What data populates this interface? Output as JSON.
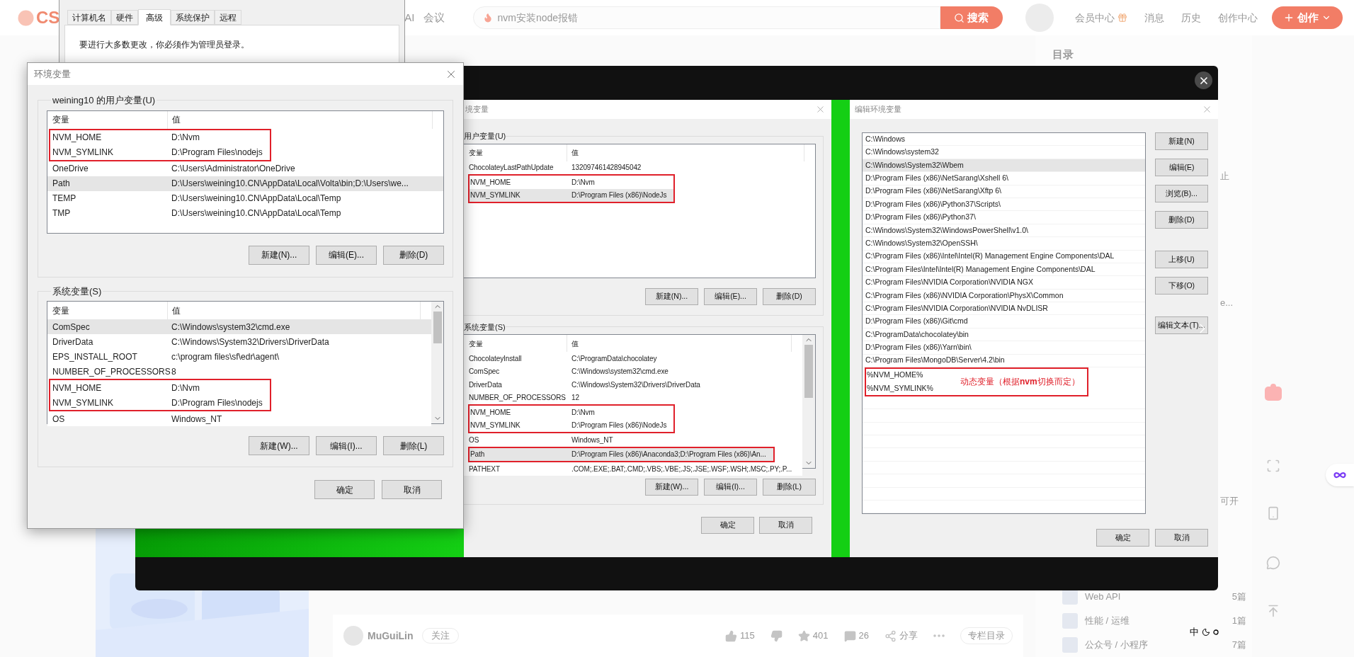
{
  "page": {
    "logo": "CS",
    "nav": [
      "AI",
      "会议"
    ],
    "search": {
      "placeholder": "nvm安装node报错",
      "button": "搜索"
    },
    "links": [
      "会员中心",
      "消息",
      "历史",
      "创作中心"
    ],
    "create_button": "创作",
    "toc_title": "目录",
    "fragments": [
      "止",
      "e...",
      "可开"
    ],
    "author": {
      "name": "MuGuiLin",
      "follow": "关注"
    },
    "actions": [
      {
        "kind": "like",
        "label": "115"
      },
      {
        "kind": "dislike"
      },
      {
        "kind": "star",
        "label": "401"
      },
      {
        "kind": "comment",
        "label": "26"
      },
      {
        "kind": "share",
        "label": "分享"
      },
      {
        "kind": "more"
      }
    ],
    "column_button": "专栏目录",
    "columns": [
      {
        "name": "Web API",
        "count": "5篇"
      },
      {
        "name": "性能 / 运维",
        "count": "1篇"
      },
      {
        "name": "公众号 / 小程序",
        "count": "7篇"
      }
    ],
    "ime": "中"
  },
  "system_properties": {
    "tabs": [
      {
        "label": "计算机名",
        "selected": false
      },
      {
        "label": "硬件",
        "selected": false
      },
      {
        "label": "高级",
        "selected": true
      },
      {
        "label": "系统保护",
        "selected": false
      },
      {
        "label": "远程",
        "selected": false
      }
    ],
    "notice": "要进行大多数更改，你必须作为管理员登录。"
  },
  "env_dialog": {
    "title": "环境变量",
    "user_group": {
      "label": "weining10 的用户变量(U)",
      "columns": [
        "变量",
        "值"
      ],
      "rows": [
        {
          "name": "NVM_HOME",
          "value": "D:\\Nvm",
          "selected": false,
          "marked": true
        },
        {
          "name": "NVM_SYMLINK",
          "value": "D:\\Program Files\\nodejs",
          "selected": false,
          "marked": true
        },
        {
          "name": "OneDrive",
          "value": "C:\\Users\\Administrator\\OneDrive",
          "selected": false,
          "marked": false
        },
        {
          "name": "Path",
          "value": "D:\\Users\\weining10.CN\\AppData\\Local\\Volta\\bin;D:\\Users\\we...",
          "selected": true,
          "marked": false
        },
        {
          "name": "TEMP",
          "value": "D:\\Users\\weining10.CN\\AppData\\Local\\Temp",
          "selected": false,
          "marked": false
        },
        {
          "name": "TMP",
          "value": "D:\\Users\\weining10.CN\\AppData\\Local\\Temp",
          "selected": false,
          "marked": false
        }
      ],
      "buttons": [
        "新建(N)...",
        "编辑(E)...",
        "删除(D)"
      ]
    },
    "system_group": {
      "label": "系统变量(S)",
      "columns": [
        "变量",
        "值"
      ],
      "rows": [
        {
          "name": "ComSpec",
          "value": "C:\\Windows\\system32\\cmd.exe",
          "selected": true,
          "marked": false
        },
        {
          "name": "DriverData",
          "value": "C:\\Windows\\System32\\Drivers\\DriverData",
          "selected": false,
          "marked": false
        },
        {
          "name": "EPS_INSTALL_ROOT",
          "value": "c:\\program files\\sf\\edr\\agent\\",
          "selected": false,
          "marked": false
        },
        {
          "name": "NUMBER_OF_PROCESSORS",
          "value": "8",
          "selected": false,
          "marked": false
        },
        {
          "name": "NVM_HOME",
          "value": "D:\\Nvm",
          "selected": false,
          "marked": true
        },
        {
          "name": "NVM_SYMLINK",
          "value": "D:\\Program Files\\nodejs",
          "selected": false,
          "marked": true
        },
        {
          "name": "OS",
          "value": "Windows_NT",
          "selected": false,
          "marked": false
        }
      ],
      "buttons": [
        "新建(W)...",
        "编辑(I)...",
        "删除(L)"
      ]
    },
    "buttons": [
      "确定",
      "取消"
    ]
  },
  "lightbox": {
    "left_screenshot": {
      "title": "境变量",
      "user_group": {
        "label": "用户变量(U)",
        "columns": [
          "变量",
          "值"
        ],
        "rows": [
          {
            "name": "ChocolateyLastPathUpdate",
            "value": "132097461428945042",
            "selected": false,
            "marked": false
          },
          {
            "name": "NVM_HOME",
            "value": "D:\\Nvm",
            "selected": false,
            "marked": true
          },
          {
            "name": "NVM_SYMLINK",
            "value": "D:\\Program Files (x86)\\NodeJs",
            "selected": true,
            "marked": true
          }
        ],
        "buttons": [
          "新建(N)...",
          "编辑(E)...",
          "删除(D)"
        ]
      },
      "system_group": {
        "label": "系统变量(S)",
        "columns": [
          "变量",
          "值"
        ],
        "rows": [
          {
            "name": "ChocolateyInstall",
            "value": "C:\\ProgramData\\chocolatey",
            "selected": false,
            "marked": false
          },
          {
            "name": "ComSpec",
            "value": "C:\\Windows\\system32\\cmd.exe",
            "selected": false,
            "marked": false
          },
          {
            "name": "DriverData",
            "value": "C:\\Windows\\System32\\Drivers\\DriverData",
            "selected": false,
            "marked": false
          },
          {
            "name": "NUMBER_OF_PROCESSORS",
            "value": "12",
            "selected": false,
            "marked": false
          },
          {
            "name": "NVM_HOME",
            "value": "D:\\Nvm",
            "selected": false,
            "marked": true
          },
          {
            "name": "NVM_SYMLINK",
            "value": "D:\\Program Files (x86)\\NodeJs",
            "selected": false,
            "marked": true
          },
          {
            "name": "OS",
            "value": "Windows_NT",
            "selected": false,
            "marked": false
          },
          {
            "name": "Path",
            "value": "D:\\Program Files (x86)\\Anaconda3;D:\\Program Files (x86)\\An...",
            "selected": true,
            "marked": true
          },
          {
            "name": "PATHEXT",
            "value": ".COM;.EXE;.BAT;.CMD;.VBS;.VBE;.JS;.JSE;.WSF;.WSH;.MSC;.PY;.P...",
            "selected": false,
            "marked": false
          }
        ],
        "buttons": [
          "新建(W)...",
          "编辑(I)...",
          "删除(L)"
        ]
      },
      "buttons": [
        "确定",
        "取消"
      ]
    },
    "right_screenshot": {
      "title": "编辑环境变量",
      "entries": [
        {
          "text": "C:\\Windows",
          "selected": false,
          "marked": false
        },
        {
          "text": "C:\\Windows\\system32",
          "selected": false,
          "marked": false
        },
        {
          "text": "C:\\Windows\\System32\\Wbem",
          "selected": true,
          "marked": false
        },
        {
          "text": "D:\\Program Files (x86)\\NetSarang\\Xshell 6\\",
          "selected": false,
          "marked": false
        },
        {
          "text": "D:\\Program Files (x86)\\NetSarang\\Xftp 6\\",
          "selected": false,
          "marked": false
        },
        {
          "text": "D:\\Program Files (x86)\\Python37\\Scripts\\",
          "selected": false,
          "marked": false
        },
        {
          "text": "D:\\Program Files (x86)\\Python37\\",
          "selected": false,
          "marked": false
        },
        {
          "text": "C:\\Windows\\System32\\WindowsPowerShell\\v1.0\\",
          "selected": false,
          "marked": false
        },
        {
          "text": "C:\\Windows\\System32\\OpenSSH\\",
          "selected": false,
          "marked": false
        },
        {
          "text": "C:\\Program Files (x86)\\Intel\\Intel(R) Management Engine Components\\DAL",
          "selected": false,
          "marked": false
        },
        {
          "text": "C:\\Program Files\\Intel\\Intel(R) Management Engine Components\\DAL",
          "selected": false,
          "marked": false
        },
        {
          "text": "C:\\Program Files\\NVIDIA Corporation\\NVIDIA NGX",
          "selected": false,
          "marked": false
        },
        {
          "text": "C:\\Program Files (x86)\\NVIDIA Corporation\\PhysX\\Common",
          "selected": false,
          "marked": false
        },
        {
          "text": "C:\\Program Files\\NVIDIA Corporation\\NVIDIA NvDLISR",
          "selected": false,
          "marked": false
        },
        {
          "text": "D:\\Program Files (x86)\\Git\\cmd",
          "selected": false,
          "marked": false
        },
        {
          "text": "C:\\ProgramData\\chocolatey\\bin",
          "selected": false,
          "marked": false
        },
        {
          "text": "D:\\Program Files (x86)\\Yarn\\bin\\",
          "selected": false,
          "marked": false
        },
        {
          "text": "C:\\Program Files\\MongoDB\\Server\\4.2\\bin",
          "selected": false,
          "marked": false
        },
        {
          "text": "%NVM_HOME%",
          "selected": false,
          "marked": true
        },
        {
          "text": "%NVM_SYMLINK%",
          "selected": false,
          "marked": true
        }
      ],
      "note": "动态变量（根据**nvm**切换而定）",
      "side_buttons": [
        "新建(N)",
        "编辑(E)",
        "浏览(B)...",
        "删除(D)",
        "上移(U)",
        "下移(O)",
        "编辑文本(T)..."
      ],
      "buttons": [
        "确定",
        "取消"
      ]
    }
  }
}
